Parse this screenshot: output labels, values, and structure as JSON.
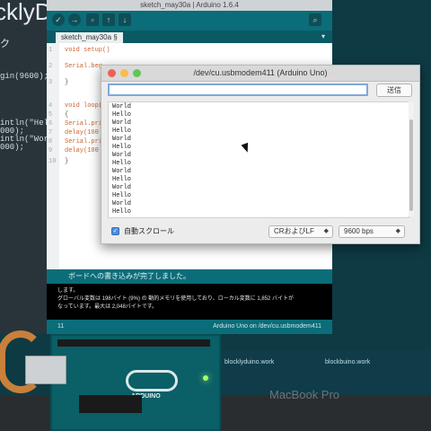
{
  "background": {
    "title": "cklyD",
    "menu_glyph": "ク",
    "code_lines": [
      "gin(9600);",
      "intln(\"Hello\");",
      "000);",
      "intln(\"World\");",
      "000);"
    ]
  },
  "arduino": {
    "window_title": "sketch_may30a | Arduino 1.6.4",
    "tab": "sketch_may30a §",
    "code": [
      {
        "n": "1",
        "t": "void setup()"
      },
      {
        "n": "2",
        "t": "  Serial.beg"
      },
      {
        "n": "3",
        "t": "}"
      },
      {
        "n": "4",
        "t": "void loop()"
      },
      {
        "n": "5",
        "t": "{"
      },
      {
        "n": "6",
        "t": "  Serial.pri"
      },
      {
        "n": "7",
        "t": "  delay(100"
      },
      {
        "n": "8",
        "t": "  Serial.pri"
      },
      {
        "n": "9",
        "t": "  delay(100"
      },
      {
        "n": "10",
        "t": "}"
      }
    ],
    "status": "ボードへの書き込みが完了しました。",
    "console_lines": [
      "します。",
      "グローバル変数は 198バイト (9%) の 動的メモリを使用しており、ローカル変数に 1,852 バイトが",
      "なっています。最大は 2,048バイトです。"
    ],
    "footer_left": "11",
    "footer_right": "Arduino Uno on /dev/cu.usbmodem411"
  },
  "serial_monitor": {
    "title": "/dev/cu.usbmodem411 (Arduino Uno)",
    "input_value": "",
    "send_label": "送信",
    "output_lines": [
      "World",
      "Hello",
      "World",
      "Hello",
      "World",
      "Hello",
      "World",
      "Hello",
      "World",
      "Hello",
      "World",
      "Hello",
      "World",
      "Hello"
    ],
    "autoscroll_label": "自動スクロール",
    "line_ending": "CRおよびLF",
    "baud_rate": "9600 bps"
  },
  "dock": {
    "labels": [
      "blocklyduino.work",
      "blockbuino.work"
    ],
    "brand": "MacBook Pro"
  },
  "board": {
    "logo_text": "ARDUINO"
  },
  "colors": {
    "arduino_teal": "#0b6d79",
    "board_teal": "#0b5f67",
    "led_green": "#a6ff6e"
  }
}
